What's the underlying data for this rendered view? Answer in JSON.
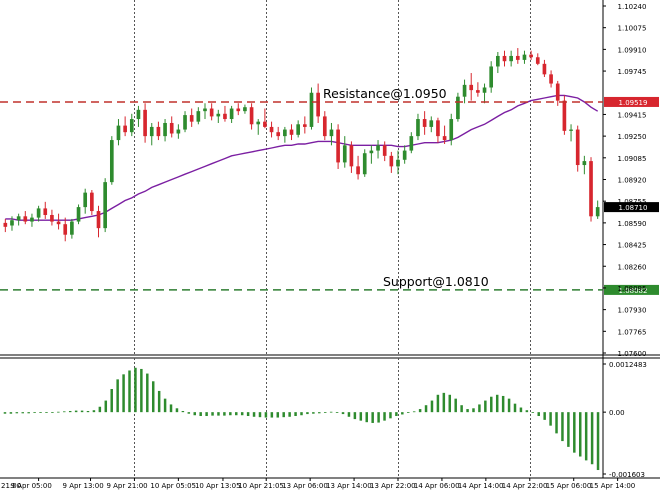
{
  "chart_data": [
    {
      "type": "candlestick",
      "title": "",
      "ylim": [
        1.076,
        1.1024
      ],
      "y_ticks": [
        "1.10240",
        "1.10075",
        "1.09910",
        "1.09745",
        "1.09415",
        "1.09250",
        "1.09085",
        "1.08920",
        "1.08755",
        "1.08590",
        "1.08425",
        "1.08260",
        "1.08095",
        "1.07930",
        "1.07765",
        "1.07600"
      ],
      "x_ticks": [
        "9 Apr 05:00",
        "9 Apr 13:00",
        "9 Apr 21:00",
        "10 Apr 05:05",
        "10 Apr 13:05",
        "10 Apr 21:05",
        "13 Apr 06:00",
        "13 Apr 14:00",
        "13 Apr 22:00",
        "14 Apr 06:00",
        "14 Apr 14:00",
        "14 Apr 22:00",
        "15 Apr 06:00",
        "15 Apr 14:00"
      ],
      "x_tick_left_partial": "21:00",
      "vertical_grid_tick_labels": [
        "9 Apr 21:00",
        "10 Apr 21:05",
        "13 Apr 22:00",
        "14 Apr 22:00"
      ],
      "grid": "dotted vertical lines only",
      "candles": [
        {
          "o": 1.0859,
          "h": 1.0862,
          "l": 1.0852,
          "c": 1.0856
        },
        {
          "o": 1.0857,
          "h": 1.0864,
          "l": 1.0853,
          "c": 1.0861
        },
        {
          "o": 1.0861,
          "h": 1.0866,
          "l": 1.0857,
          "c": 1.0864
        },
        {
          "o": 1.0864,
          "h": 1.0868,
          "l": 1.0858,
          "c": 1.086
        },
        {
          "o": 1.086,
          "h": 1.0866,
          "l": 1.0856,
          "c": 1.0863
        },
        {
          "o": 1.0863,
          "h": 1.0872,
          "l": 1.086,
          "c": 1.087
        },
        {
          "o": 1.087,
          "h": 1.0875,
          "l": 1.0862,
          "c": 1.0865
        },
        {
          "o": 1.0865,
          "h": 1.0869,
          "l": 1.0857,
          "c": 1.086
        },
        {
          "o": 1.086,
          "h": 1.0866,
          "l": 1.0854,
          "c": 1.0858
        },
        {
          "o": 1.0858,
          "h": 1.0863,
          "l": 1.0845,
          "c": 1.085
        },
        {
          "o": 1.085,
          "h": 1.0862,
          "l": 1.0847,
          "c": 1.086
        },
        {
          "o": 1.086,
          "h": 1.0873,
          "l": 1.0858,
          "c": 1.0871
        },
        {
          "o": 1.0871,
          "h": 1.0885,
          "l": 1.0866,
          "c": 1.0882
        },
        {
          "o": 1.0882,
          "h": 1.0884,
          "l": 1.0865,
          "c": 1.0868
        },
        {
          "o": 1.0868,
          "h": 1.0872,
          "l": 1.0848,
          "c": 1.0855
        },
        {
          "o": 1.0855,
          "h": 1.0893,
          "l": 1.0852,
          "c": 1.089
        },
        {
          "o": 1.089,
          "h": 1.0925,
          "l": 1.0888,
          "c": 1.0922
        },
        {
          "o": 1.0922,
          "h": 1.0938,
          "l": 1.0918,
          "c": 1.0933
        },
        {
          "o": 1.0933,
          "h": 1.094,
          "l": 1.0925,
          "c": 1.0928
        },
        {
          "o": 1.0928,
          "h": 1.0942,
          "l": 1.0925,
          "c": 1.0938
        },
        {
          "o": 1.0938,
          "h": 1.0948,
          "l": 1.0932,
          "c": 1.0945
        },
        {
          "o": 1.0945,
          "h": 1.095,
          "l": 1.092,
          "c": 1.0925
        },
        {
          "o": 1.0925,
          "h": 1.0935,
          "l": 1.0918,
          "c": 1.0932
        },
        {
          "o": 1.0932,
          "h": 1.0936,
          "l": 1.0922,
          "c": 1.0925
        },
        {
          "o": 1.0925,
          "h": 1.0938,
          "l": 1.0921,
          "c": 1.0935
        },
        {
          "o": 1.0935,
          "h": 1.094,
          "l": 1.0924,
          "c": 1.0927
        },
        {
          "o": 1.0927,
          "h": 1.0934,
          "l": 1.0923,
          "c": 1.093
        },
        {
          "o": 1.093,
          "h": 1.0944,
          "l": 1.0928,
          "c": 1.0941
        },
        {
          "o": 1.0941,
          "h": 1.0946,
          "l": 1.0932,
          "c": 1.0936
        },
        {
          "o": 1.0936,
          "h": 1.0947,
          "l": 1.0934,
          "c": 1.0944
        },
        {
          "o": 1.0944,
          "h": 1.095,
          "l": 1.0938,
          "c": 1.0946
        },
        {
          "o": 1.0946,
          "h": 1.095,
          "l": 1.0937,
          "c": 1.094
        },
        {
          "o": 1.094,
          "h": 1.0945,
          "l": 1.0935,
          "c": 1.0942
        },
        {
          "o": 1.0942,
          "h": 1.0948,
          "l": 1.0936,
          "c": 1.0938
        },
        {
          "o": 1.0938,
          "h": 1.0948,
          "l": 1.0935,
          "c": 1.0946
        },
        {
          "o": 1.0946,
          "h": 1.095,
          "l": 1.0941,
          "c": 1.0944
        },
        {
          "o": 1.0944,
          "h": 1.0949,
          "l": 1.0942,
          "c": 1.0947
        },
        {
          "o": 1.0947,
          "h": 1.095,
          "l": 1.093,
          "c": 1.0934
        },
        {
          "o": 1.0934,
          "h": 1.0938,
          "l": 1.0926,
          "c": 1.0936
        },
        {
          "o": 1.0936,
          "h": 1.0946,
          "l": 1.0931,
          "c": 1.0932
        },
        {
          "o": 1.0932,
          "h": 1.0936,
          "l": 1.0924,
          "c": 1.0928
        },
        {
          "o": 1.0928,
          "h": 1.0932,
          "l": 1.0922,
          "c": 1.0925
        },
        {
          "o": 1.0925,
          "h": 1.0932,
          "l": 1.092,
          "c": 1.093
        },
        {
          "o": 1.093,
          "h": 1.0934,
          "l": 1.0922,
          "c": 1.0926
        },
        {
          "o": 1.0926,
          "h": 1.0937,
          "l": 1.0924,
          "c": 1.0934
        },
        {
          "o": 1.0934,
          "h": 1.094,
          "l": 1.0927,
          "c": 1.0932
        },
        {
          "o": 1.0932,
          "h": 1.0962,
          "l": 1.093,
          "c": 1.0958
        },
        {
          "o": 1.0958,
          "h": 1.0965,
          "l": 1.0935,
          "c": 1.094
        },
        {
          "o": 1.094,
          "h": 1.0944,
          "l": 1.0922,
          "c": 1.0925
        },
        {
          "o": 1.0925,
          "h": 1.0935,
          "l": 1.0918,
          "c": 1.093
        },
        {
          "o": 1.093,
          "h": 1.0934,
          "l": 1.09,
          "c": 1.0905
        },
        {
          "o": 1.0905,
          "h": 1.0925,
          "l": 1.0901,
          "c": 1.0918
        },
        {
          "o": 1.0918,
          "h": 1.0921,
          "l": 1.0897,
          "c": 1.0902
        },
        {
          "o": 1.0902,
          "h": 1.091,
          "l": 1.0892,
          "c": 1.0896
        },
        {
          "o": 1.0896,
          "h": 1.0915,
          "l": 1.0894,
          "c": 1.0912
        },
        {
          "o": 1.0912,
          "h": 1.0918,
          "l": 1.0904,
          "c": 1.0914
        },
        {
          "o": 1.0914,
          "h": 1.0922,
          "l": 1.0908,
          "c": 1.0918
        },
        {
          "o": 1.0918,
          "h": 1.0921,
          "l": 1.0906,
          "c": 1.091
        },
        {
          "o": 1.091,
          "h": 1.0913,
          "l": 1.0897,
          "c": 1.0902
        },
        {
          "o": 1.0902,
          "h": 1.0914,
          "l": 1.0896,
          "c": 1.0907
        },
        {
          "o": 1.0907,
          "h": 1.0918,
          "l": 1.0904,
          "c": 1.0914
        },
        {
          "o": 1.0914,
          "h": 1.0928,
          "l": 1.0912,
          "c": 1.0925
        },
        {
          "o": 1.0925,
          "h": 1.0942,
          "l": 1.0922,
          "c": 1.0938
        },
        {
          "o": 1.0938,
          "h": 1.0944,
          "l": 1.0926,
          "c": 1.0932
        },
        {
          "o": 1.0932,
          "h": 1.094,
          "l": 1.0928,
          "c": 1.0937
        },
        {
          "o": 1.0937,
          "h": 1.0939,
          "l": 1.092,
          "c": 1.0925
        },
        {
          "o": 1.0925,
          "h": 1.0933,
          "l": 1.0919,
          "c": 1.0922
        },
        {
          "o": 1.0922,
          "h": 1.0942,
          "l": 1.0918,
          "c": 1.0938
        },
        {
          "o": 1.0938,
          "h": 1.0958,
          "l": 1.0936,
          "c": 1.0955
        },
        {
          "o": 1.0955,
          "h": 1.0968,
          "l": 1.095,
          "c": 1.0964
        },
        {
          "o": 1.0964,
          "h": 1.0973,
          "l": 1.0952,
          "c": 1.096
        },
        {
          "o": 1.096,
          "h": 1.0966,
          "l": 1.0955,
          "c": 1.0958
        },
        {
          "o": 1.0958,
          "h": 1.0965,
          "l": 1.095,
          "c": 1.0962
        },
        {
          "o": 1.0962,
          "h": 1.0982,
          "l": 1.0958,
          "c": 1.0978
        },
        {
          "o": 1.0978,
          "h": 1.0989,
          "l": 1.0973,
          "c": 1.0986
        },
        {
          "o": 1.0986,
          "h": 1.099,
          "l": 1.0978,
          "c": 1.0982
        },
        {
          "o": 1.0982,
          "h": 1.099,
          "l": 1.0978,
          "c": 1.0986
        },
        {
          "o": 1.0986,
          "h": 1.0992,
          "l": 1.098,
          "c": 1.0983
        },
        {
          "o": 1.0983,
          "h": 1.099,
          "l": 1.098,
          "c": 1.0987
        },
        {
          "o": 1.0987,
          "h": 1.099,
          "l": 1.0983,
          "c": 1.0985
        },
        {
          "o": 1.0985,
          "h": 1.0988,
          "l": 1.0979,
          "c": 1.098
        },
        {
          "o": 1.098,
          "h": 1.0983,
          "l": 1.097,
          "c": 1.0972
        },
        {
          "o": 1.0972,
          "h": 1.0975,
          "l": 1.0962,
          "c": 1.0965
        },
        {
          "o": 1.0965,
          "h": 1.0967,
          "l": 1.0948,
          "c": 1.0952
        },
        {
          "o": 1.0952,
          "h": 1.0956,
          "l": 1.0926,
          "c": 1.0929
        },
        {
          "o": 1.0929,
          "h": 1.0934,
          "l": 1.0921,
          "c": 1.093
        },
        {
          "o": 1.093,
          "h": 1.0933,
          "l": 1.0898,
          "c": 1.0903
        },
        {
          "o": 1.0903,
          "h": 1.091,
          "l": 1.0896,
          "c": 1.0906
        },
        {
          "o": 1.0906,
          "h": 1.0909,
          "l": 1.086,
          "c": 1.0864
        },
        {
          "o": 1.0864,
          "h": 1.0876,
          "l": 1.0862,
          "c": 1.0871
        }
      ],
      "moving_average": [
        1.0862,
        1.0862,
        1.0861,
        1.0861,
        1.0861,
        1.0861,
        1.0861,
        1.0861,
        1.0861,
        1.0861,
        1.0861,
        1.0862,
        1.0863,
        1.0864,
        1.0865,
        1.0867,
        1.087,
        1.0873,
        1.0876,
        1.0878,
        1.0881,
        1.0883,
        1.0886,
        1.0888,
        1.089,
        1.0892,
        1.0894,
        1.0896,
        1.0898,
        1.09,
        1.0902,
        1.0904,
        1.0906,
        1.0908,
        1.091,
        1.0911,
        1.0912,
        1.0913,
        1.0914,
        1.0915,
        1.0916,
        1.0917,
        1.0918,
        1.0918,
        1.0919,
        1.0919,
        1.092,
        1.0921,
        1.0921,
        1.0921,
        1.092,
        1.0919,
        1.0918,
        1.0918,
        1.0918,
        1.0918,
        1.0918,
        1.0918,
        1.0918,
        1.0917,
        1.0917,
        1.0918,
        1.0919,
        1.092,
        1.092,
        1.092,
        1.0921,
        1.0922,
        1.0924,
        1.0927,
        1.093,
        1.0932,
        1.0934,
        1.0937,
        1.094,
        1.0943,
        1.0945,
        1.0948,
        1.095,
        1.0952,
        1.0953,
        1.0954,
        1.0955,
        1.0956,
        1.0956,
        1.0955,
        1.0954,
        1.0951,
        1.0947,
        1.0944
      ],
      "horizontal_lines": [
        {
          "label": "Resistance@1.0950",
          "value": 1.0951,
          "axis_label": "1.09519",
          "color": "#c0312c",
          "style": "dashed"
        },
        {
          "label": "Support@1.0810",
          "value": 1.0808,
          "axis_label": "1.08082",
          "color": "#2e7d32",
          "style": "dashed"
        }
      ],
      "last_price": {
        "value": 1.0871,
        "axis_label": "1.08710"
      },
      "colors": {
        "bull": "#2e8b2e",
        "bear": "#d7262e",
        "ma": "#7b1fa2",
        "grid": "#555555"
      }
    },
    {
      "type": "bar",
      "title": "",
      "ylim": [
        -0.001603,
        0.001248
      ],
      "y_ticks": [
        "0.0012483",
        "0.00",
        "-0.001603"
      ],
      "values": [
        -4e-05,
        -4e-05,
        -3e-05,
        -3e-05,
        -3e-05,
        -2e-05,
        -2e-05,
        -1e-05,
        0.0,
        1e-05,
        2e-05,
        3e-05,
        4e-05,
        4e-05,
        3e-05,
        5e-05,
        0.00014,
        0.0003,
        0.0006,
        0.00085,
        0.00098,
        0.00108,
        0.00115,
        0.00112,
        0.001,
        0.0008,
        0.00055,
        0.00035,
        0.0002,
        0.0001,
        3e-05,
        -4e-05,
        -8e-05,
        -0.0001,
        -0.0001,
        -9e-05,
        -9e-05,
        -9e-05,
        -8e-05,
        -8e-05,
        -8e-05,
        -0.0001,
        -0.00012,
        -0.00013,
        -0.00014,
        -0.00014,
        -0.00014,
        -0.00013,
        -0.00012,
        -0.0001,
        -8e-05,
        -5e-05,
        -4e-05,
        -3e-05,
        -1e-05,
        1e-05,
        0.0,
        -5e-05,
        -0.00012,
        -0.00018,
        -0.00022,
        -0.00026,
        -0.00028,
        -0.00027,
        -0.00022,
        -0.00016,
        -0.0001,
        -6e-05,
        -2e-05,
        2e-05,
        8e-05,
        0.00018,
        0.0003,
        0.00045,
        0.0005,
        0.00045,
        0.00035,
        0.00018,
        8e-05,
        0.0001,
        0.0002,
        0.0003,
        0.0004,
        0.00045,
        0.00042,
        0.00035,
        0.00022,
        0.00012,
        5e-05,
        -2e-05,
        -0.0001,
        -0.0002,
        -0.00035,
        -0.00055,
        -0.00075,
        -0.0009,
        -0.00105,
        -0.00115,
        -0.00125,
        -0.00135,
        -0.0015
      ],
      "color": "#2e8b2e"
    }
  ]
}
